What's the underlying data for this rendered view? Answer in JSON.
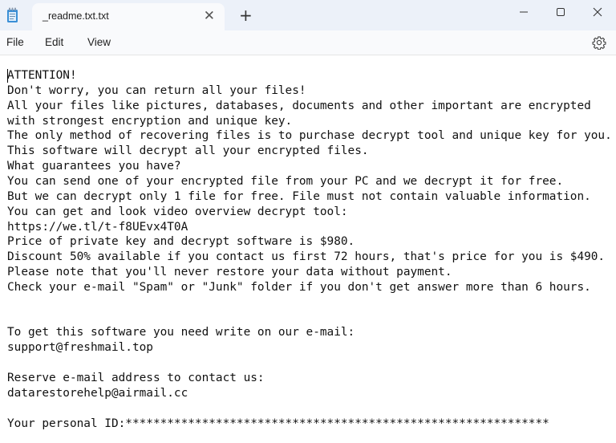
{
  "tab": {
    "title": "_readme.txt.txt",
    "close_glyph": "✕"
  },
  "window": {
    "minimize": "—",
    "maximize": "☐",
    "close": "✕",
    "new_tab": "+"
  },
  "menu": {
    "file": "File",
    "edit": "Edit",
    "view": "View"
  },
  "icons": {
    "app": "notepad-icon",
    "settings": "gear-icon"
  },
  "document": {
    "lines": [
      "ATTENTION!",
      "Don't worry, you can return all your files!",
      "All your files like pictures, databases, documents and other important are encrypted",
      "with strongest encryption and unique key.",
      "The only method of recovering files is to purchase decrypt tool and unique key for you.",
      "This software will decrypt all your encrypted files.",
      "What guarantees you have?",
      "You can send one of your encrypted file from your PC and we decrypt it for free.",
      "But we can decrypt only 1 file for free. File must not contain valuable information.",
      "You can get and look video overview decrypt tool:",
      "https://we.tl/t-f8UEvx4T0A",
      "Price of private key and decrypt software is $980.",
      "Discount 50% available if you contact us first 72 hours, that's price for you is $490.",
      "Please note that you'll never restore your data without payment.",
      "Check your e-mail \"Spam\" or \"Junk\" folder if you don't get answer more than 6 hours.",
      "",
      "",
      "To get this software you need write on our e-mail:",
      "support@freshmail.top",
      "",
      "Reserve e-mail address to contact us:",
      "datarestorehelp@airmail.cc",
      "",
      "Your personal ID:*************************************************************"
    ]
  }
}
